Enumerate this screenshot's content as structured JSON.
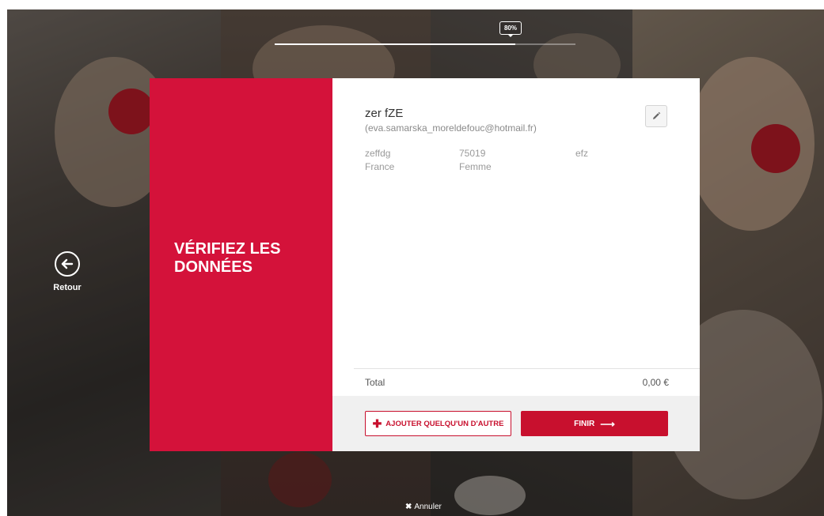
{
  "progress": {
    "label": "80%",
    "value": 0.8
  },
  "back": {
    "label": "Retour"
  },
  "card": {
    "title": "VÉRIFIEZ LES DONNÉES"
  },
  "person": {
    "name": "zer fZE",
    "email": "(eva.samarska_moreldefouc@hotmail.fr)",
    "address": "zeffdg",
    "postal_code": "75019",
    "city": "efz",
    "country": "France",
    "gender": "Femme"
  },
  "summary": {
    "total_label": "Total",
    "total_value": "0,00 €"
  },
  "actions": {
    "add_label": "AJOUTER QUELQU'UN D'AUTRE",
    "finish_label": "FINIR",
    "cancel_label": "Annuler"
  },
  "colors": {
    "brand": "#d4123a",
    "button": "#c8102e"
  },
  "icons": {
    "edit": "pencil-icon",
    "back": "arrow-left-circle-icon",
    "add": "plus-icon",
    "finish": "arrow-right-icon",
    "cancel": "close-icon"
  }
}
